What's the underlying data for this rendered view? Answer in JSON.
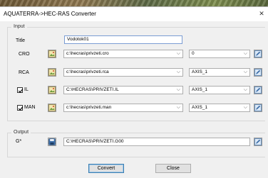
{
  "window": {
    "title": "AQUATERRA->HEC-RAS Converter",
    "close_glyph": "✕"
  },
  "input_group": {
    "legend": "Input"
  },
  "title_row": {
    "label": "Title",
    "value": "Vodotok01"
  },
  "rows": [
    {
      "label": "CRO",
      "path": "c:\\hecras\\privzeti.cro",
      "option": "0",
      "checkbox": false,
      "icon": "image-icon"
    },
    {
      "label": "RCA",
      "path": "c:\\hecras\\privzeti.rca",
      "option": "AXIS_1",
      "checkbox": false,
      "icon": "image-icon"
    },
    {
      "label": "IL",
      "path": "C:\\HECRAS\\PRIVZETI.IL",
      "option": "AXIS_1",
      "checkbox": true,
      "checked": true,
      "icon": "image-icon"
    },
    {
      "label": "MAN",
      "path": "c:\\hecras\\privzeti.man",
      "option": "AXIS_1",
      "checkbox": true,
      "checked": true,
      "icon": "image-icon"
    }
  ],
  "output_group": {
    "legend": "Output",
    "label": "G*",
    "path": "C:\\HECRAS\\PRIVZETI.G00"
  },
  "buttons": {
    "convert": "Convert",
    "close": "Close"
  },
  "colors": {
    "accent_border": "#7a9cd3",
    "default_button_border": "#3c7fb1"
  }
}
